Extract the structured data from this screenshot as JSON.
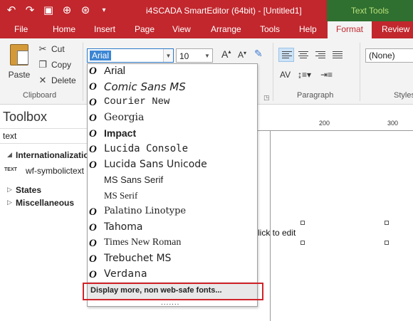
{
  "title_bar": {
    "title": "i4SCADA SmartEditor (64bit) - [Untitled1]",
    "context_tab": "Text Tools",
    "quick_access": [
      "undo-icon",
      "redo-icon",
      "save-icon",
      "preview-icon",
      "publish-icon",
      "customize-icon"
    ]
  },
  "tabs": [
    "File",
    "Home",
    "Insert",
    "Page",
    "View",
    "Arrange",
    "Tools",
    "Help",
    "Format",
    "Review"
  ],
  "active_tab": "Format",
  "clipboard": {
    "paste": "Paste",
    "cut": "Cut",
    "copy": "Copy",
    "delete": "Delete",
    "group_label": "Clipboard"
  },
  "font": {
    "name": "Arial",
    "size": "10",
    "grow": "A",
    "shrink": "A"
  },
  "paragraph": {
    "group_label": "Paragraph"
  },
  "styles": {
    "value": "(None)",
    "group_label": "Styles"
  },
  "toolbox": {
    "title": "Toolbox",
    "search_value": "text",
    "tree": {
      "internationalization": "Internationalization",
      "text_badge": "TEXT",
      "symbolic_text": "wf-symbolictext",
      "states": "States",
      "misc": "Miscellaneous"
    }
  },
  "ruler": {
    "labels": [
      "200",
      "300"
    ]
  },
  "canvas": {
    "placeholder": "lick to edit",
    "drag_dots": "......."
  },
  "font_list": {
    "truetype_glyph": "O",
    "items": [
      {
        "name": "Arial",
        "truetype": true
      },
      {
        "name": "Comic Sans MS",
        "truetype": true
      },
      {
        "name": "Courier New",
        "truetype": true
      },
      {
        "name": "Georgia",
        "truetype": true
      },
      {
        "name": "Impact",
        "truetype": true
      },
      {
        "name": "Lucida Console",
        "truetype": true
      },
      {
        "name": "Lucida Sans Unicode",
        "truetype": true
      },
      {
        "name": "MS Sans Serif",
        "truetype": false
      },
      {
        "name": "MS Serif",
        "truetype": false
      },
      {
        "name": "Palatino Linotype",
        "truetype": true
      },
      {
        "name": "Tahoma",
        "truetype": true
      },
      {
        "name": "Times New Roman",
        "truetype": true
      },
      {
        "name": "Trebuchet MS",
        "truetype": true
      },
      {
        "name": "Verdana",
        "truetype": true
      }
    ],
    "more": "Display more, non web-safe fonts..."
  },
  "colors": {
    "brand": "#c1272d",
    "context": "#2f6f2f",
    "highlight": "#d0242a",
    "selection": "#3b86d4"
  }
}
